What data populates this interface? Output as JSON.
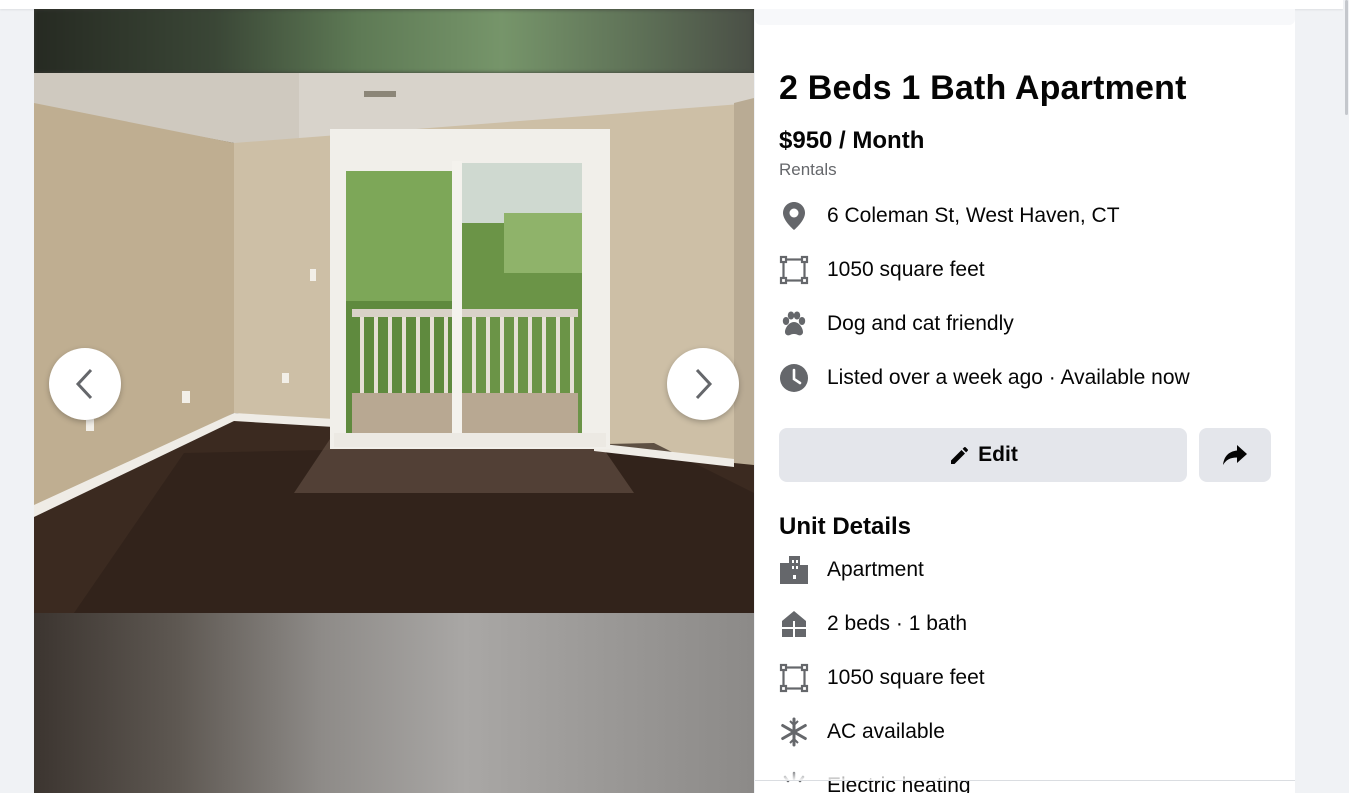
{
  "listing": {
    "title": "2 Beds 1 Bath Apartment",
    "price": "$950 / Month",
    "category": "Rentals"
  },
  "summary": [
    {
      "icon": "location-pin-icon",
      "text": "6 Coleman St, West Haven, CT"
    },
    {
      "icon": "square-footage-icon",
      "text": "1050 square feet"
    },
    {
      "icon": "paw-icon",
      "text": "Dog and cat friendly"
    },
    {
      "icon": "clock-icon",
      "text": "Listed over a week ago · Available now"
    }
  ],
  "actions": {
    "edit_label": "Edit",
    "share_icon": "share-arrow-icon"
  },
  "unit_details": {
    "title": "Unit Details",
    "items": [
      {
        "icon": "building-icon",
        "text": "Apartment"
      },
      {
        "icon": "house-icon",
        "text": "2 beds · 1 bath"
      },
      {
        "icon": "square-footage-icon",
        "text": "1050 square feet"
      },
      {
        "icon": "snowflake-icon",
        "text": "AC available"
      },
      {
        "icon": "electric-heating-icon",
        "text": "Electric heating"
      }
    ]
  },
  "viewer": {
    "prev_icon": "chevron-left-icon",
    "next_icon": "chevron-right-icon"
  },
  "colors": {
    "icon_gray": "#65676b",
    "button_bg": "#e4e6eb",
    "page_bg": "#f0f2f5"
  }
}
